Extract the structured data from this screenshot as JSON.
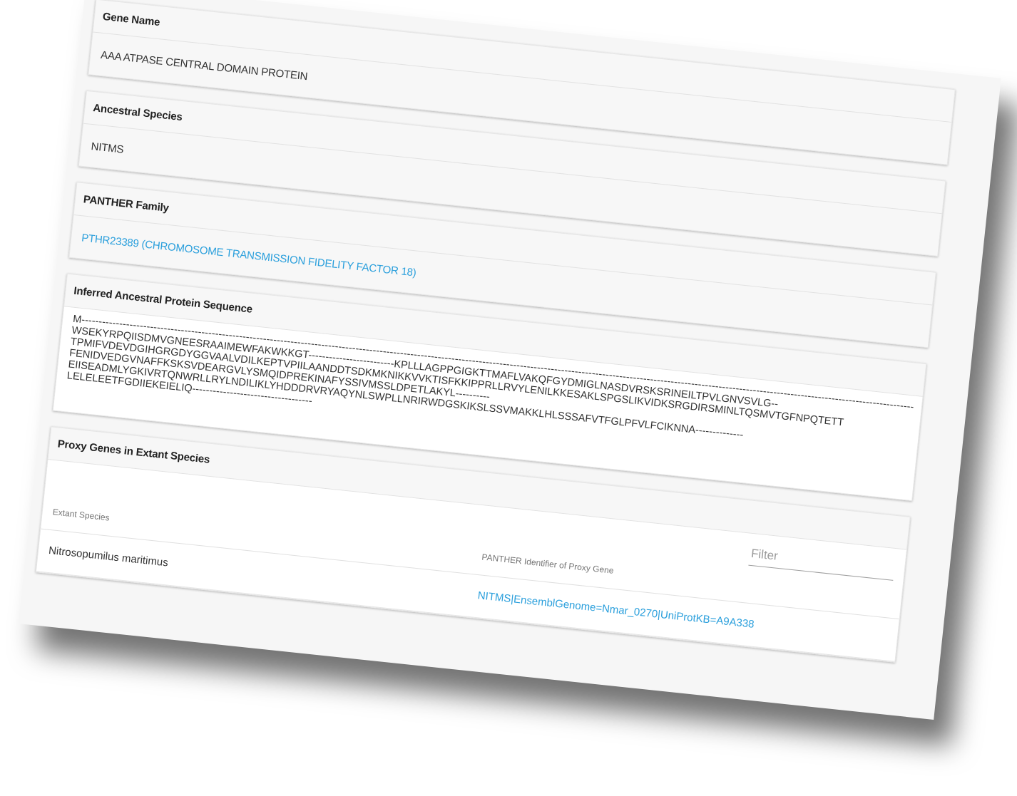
{
  "gene": {
    "header": "Gene Name",
    "value": "AAA ATPASE CENTRAL DOMAIN PROTEIN"
  },
  "ancestral": {
    "header": "Ancestral Species",
    "value": "NITMS"
  },
  "family": {
    "header": "PANTHER Family",
    "link": "PTHR23389 (CHROMOSOME TRANSMISSION FIDELITY FACTOR 18)"
  },
  "sequence": {
    "header": "Inferred Ancestral Protein Sequence",
    "text": "M---------------------------------------------------------------------------------------------------------------------------------------------------------------------------------------------------------------------------------------------------\nWSEKYRPQIISDMVGNEESRAAIMEWFAKWKKGT-------------------------KPLLLAGPPGIGKTTMAFLVAKQFGYDMIGLNASDVRSKSRINEILTPVLGNVSVLG--\nTPMIFVDEVDGIHGRGDYGGVAALVDILKEPTVPIILAANDDTSDKMKNIKKVVKTISFKKIPPRLLRVYLENILKKESAKLSPGSLIKVIDKSRGDIRSMINLTQSMVTGFNPQTETT\nFENIDVEDGVNAFFKSKSVDEARGVLYSMQIDPREKINAFYSSIVMSSLDPETLAKYL----------\nEIISEADMLYGKIVRTQNWRLLRYLNDILIKLYHDDDRVRYAQYNLSWPLLNRIRWDGSKIKSLSSVMAKKLHLSSSAFVTFGLPFVLFCIKNNA--------------\nLELELEETFGDIIEKEIELIQ-----------------------------------"
  },
  "proxy": {
    "header": "Proxy Genes in Extant Species",
    "filter_placeholder": "Filter",
    "columns": [
      "Extant Species",
      "PANTHER Identifier of Proxy Gene"
    ],
    "rows": [
      {
        "species": "Nitrosopumilus maritimus",
        "identifier": "NITMS|EnsemblGenome=Nmar_0270|UniProtKB=A9A338"
      }
    ]
  }
}
